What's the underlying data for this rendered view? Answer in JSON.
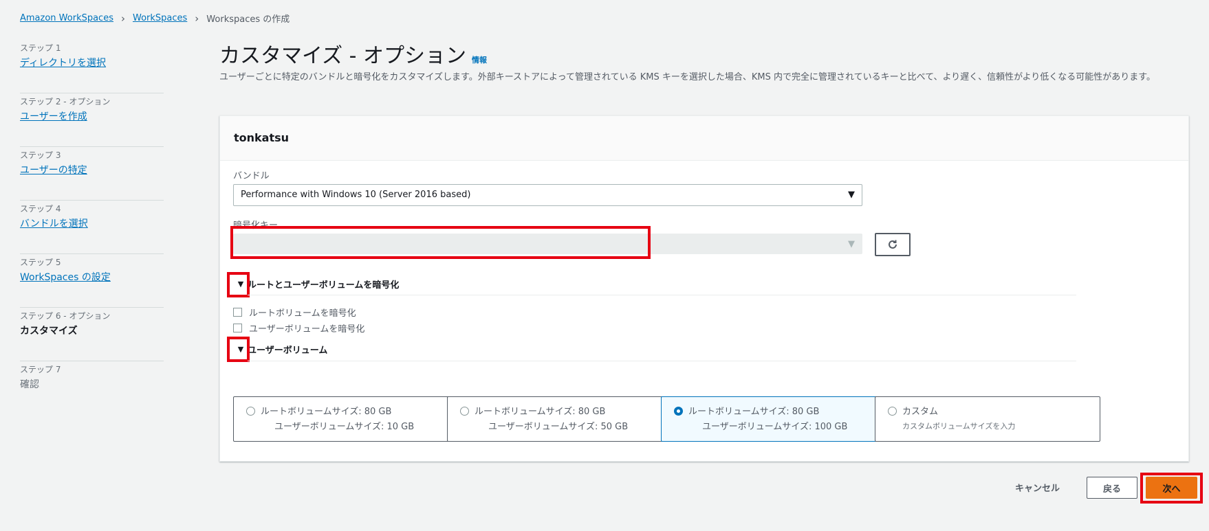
{
  "breadcrumb": {
    "items": [
      "Amazon WorkSpaces",
      "WorkSpaces",
      "Workspaces の作成"
    ]
  },
  "steps": [
    {
      "num": "ステップ 1",
      "label": "ディレクトリを選択"
    },
    {
      "num": "ステップ 2 - オプション",
      "label": "ユーザーを作成"
    },
    {
      "num": "ステップ 3",
      "label": "ユーザーの特定"
    },
    {
      "num": "ステップ 4",
      "label": "バンドルを選択"
    },
    {
      "num": "ステップ 5",
      "label": "WorkSpaces の設定"
    },
    {
      "num": "ステップ 6 - オプション",
      "label": "カスタマイズ"
    },
    {
      "num": "ステップ 7",
      "label": "確認"
    }
  ],
  "page": {
    "title": "カスタマイズ - オプション",
    "info": "情報",
    "description": "ユーザーごとに特定のバンドルと暗号化をカスタマイズします。外部キーストアによって管理されている KMS キーを選択した場合、KMS 内で完全に管理されているキーと比べて、より遅く、信頼性がより低くなる可能性があります。"
  },
  "card": {
    "title": "tonkatsu",
    "bundle_label": "バンドル",
    "bundle_value": "Performance with Windows 10 (Server 2016 based)",
    "key_label": "暗号化キー",
    "key_value": "",
    "encrypt_section": "ルートとユーザーボリュームを暗号化",
    "encrypt_root": "ルートボリュームを暗号化",
    "encrypt_user": "ユーザーボリュームを暗号化",
    "volume_section": "ユーザーボリューム",
    "volume_options": [
      {
        "line1": "ルートボリュームサイズ: 80 GB",
        "line2": "ユーザーボリュームサイズ: 10 GB"
      },
      {
        "line1": "ルートボリュームサイズ: 80 GB",
        "line2": "ユーザーボリュームサイズ: 50 GB"
      },
      {
        "line1": "ルートボリュームサイズ: 80 GB",
        "line2": "ユーザーボリュームサイズ: 100 GB"
      },
      {
        "line1": "カスタム",
        "line2": "カスタムボリュームサイズを入力"
      }
    ],
    "selected_volume_index": 2
  },
  "footer": {
    "cancel": "キャンセル",
    "back": "戻る",
    "next": "次へ"
  },
  "colors": {
    "link": "#0073bb",
    "primary": "#ec7211",
    "highlight": "#e60012"
  }
}
